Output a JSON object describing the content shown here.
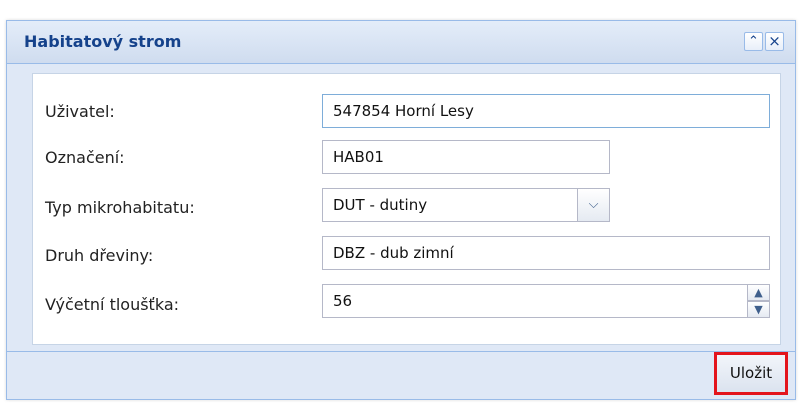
{
  "window": {
    "title": "Habitatový strom",
    "collapse_icon": "double-chevron-up-icon",
    "close_icon": "close-icon"
  },
  "form": {
    "user": {
      "label": "Uživatel:",
      "value": "547854 Horní Lesy"
    },
    "designation": {
      "label": "Označení:",
      "value": "HAB01"
    },
    "microhabitat_type": {
      "label": "Typ mikrohabitatu:",
      "value": "DUT - dutiny"
    },
    "tree_species": {
      "label": "Druh dřeviny:",
      "value": "DBZ - dub zimní"
    },
    "dbh": {
      "label": "Výčetní tloušťka:",
      "value": "56"
    }
  },
  "footer": {
    "save_label": "Uložit"
  },
  "colors": {
    "title_text": "#15428b",
    "panel_border": "#99bbe8",
    "panel_background": "#dfe8f6",
    "save_highlight": "#e3141c"
  }
}
